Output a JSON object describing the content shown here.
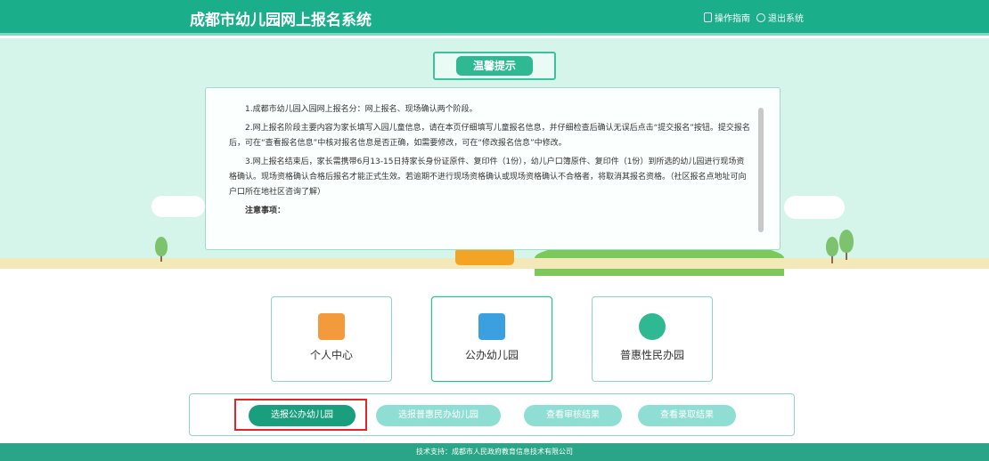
{
  "header": {
    "title": "成都市幼儿园网上报名系统",
    "links": [
      {
        "label": "操作指南",
        "icon": "document-icon"
      },
      {
        "label": "退出系统",
        "icon": "exit-icon"
      }
    ]
  },
  "notice": {
    "title": "温馨提示",
    "paragraphs": [
      "1.成都市幼儿园入园网上报名分：网上报名、现场确认两个阶段。",
      "2.网上报名阶段主要内容为家长填写入园儿童信息，请在本页仔细填写儿童报名信息，并仔细检查后确认无误后点击“提交报名”按钮。提交报名后，可在“查看报名信息”中核对报名信息是否正确，如需要修改，可在“修改报名信息”中修改。",
      "3.网上报名结束后，家长需携带6月13-15日持家长身份证原件、复印件（1份），幼儿户口簿原件、复印件（1份）到所选的幼儿园进行现场资格确认。现场资格确认合格后报名才能正式生效。若逾期不进行现场资格确认或现场资格确认不合格者，将取消其报名资格。（社区报名点地址可向户口所在地社区咨询了解）",
      "注意事项："
    ]
  },
  "cards": [
    {
      "label": "个人中心",
      "color": "#f39a3c"
    },
    {
      "label": "公办幼儿园",
      "color": "#3aa0e0"
    },
    {
      "label": "普惠性民办园",
      "color": "#2fb993"
    }
  ],
  "actions": [
    {
      "label": "选报公办幼儿园"
    },
    {
      "label": "选报普惠民办幼儿园"
    },
    {
      "label": "查看审核结果"
    },
    {
      "label": "查看录取结果"
    }
  ],
  "footer": {
    "text": "技术支持：成都市人民政府教育信息技术有限公司"
  }
}
